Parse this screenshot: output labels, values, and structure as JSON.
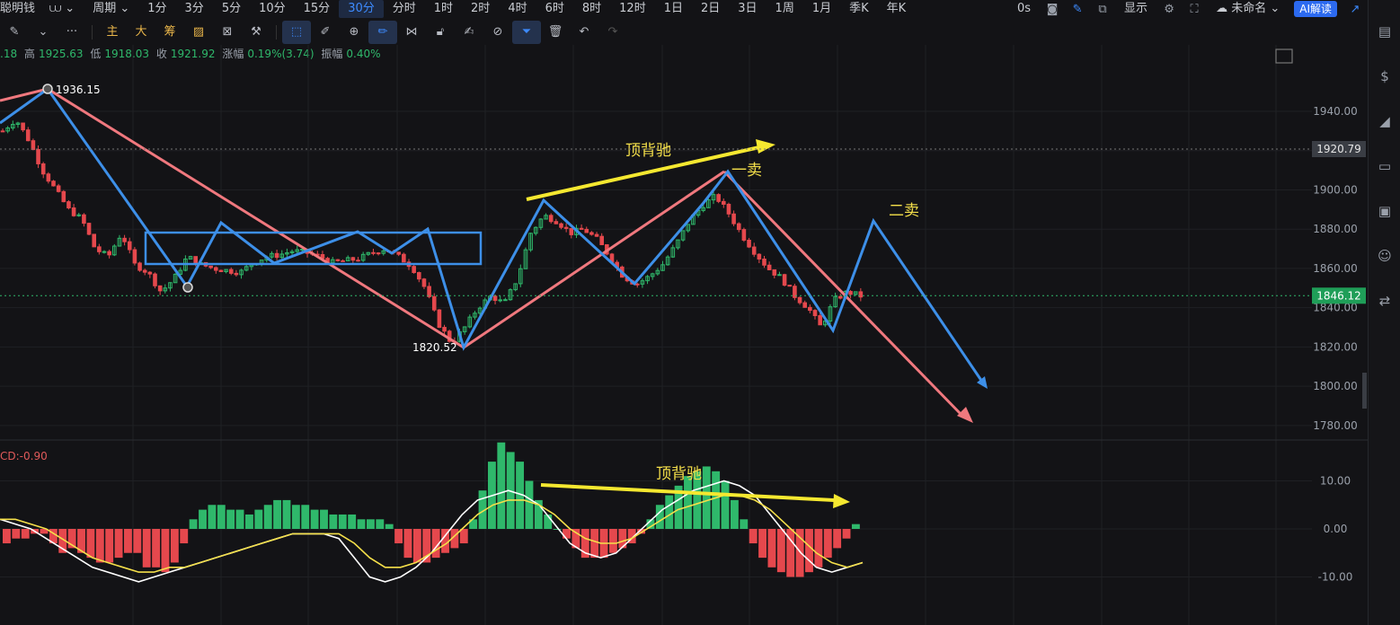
{
  "topbar": {
    "brand": "聪明钱",
    "chart_type_icon": "bar-chart-icon",
    "period_label": "周期",
    "timeframes": [
      "1分",
      "3分",
      "5分",
      "10分",
      "15分",
      "30分",
      "分时",
      "1时",
      "2时",
      "4时",
      "6时",
      "8时",
      "12时",
      "1日",
      "2日",
      "3日",
      "1周",
      "1月",
      "季K",
      "年K"
    ],
    "active_timeframe": "30分",
    "countdown": "0s",
    "display_label": "显示",
    "layout_name": "未命名",
    "ai_button": "AI解读"
  },
  "toolbar": {
    "indicator_buttons": [
      "主",
      "大",
      "筹"
    ],
    "more": "···"
  },
  "ohlc": {
    "open_fragment": ".18",
    "high_label": "高",
    "high": "1925.63",
    "low_label": "低",
    "low": "1918.03",
    "close_label": "收",
    "close": "1921.92",
    "change_label": "涨幅",
    "change": "0.19%(3.74)",
    "amplitude_label": "振幅",
    "amplitude": "0.40%"
  },
  "macd": {
    "label": "CD:-0.90"
  },
  "chart_data": {
    "type": "candlestick",
    "timeframe": "30分",
    "price_axis": {
      "ticks": [
        1940,
        1920,
        1900,
        1880,
        1860,
        1840,
        1820,
        1800,
        1780
      ],
      "tick_labels": [
        "1940.00",
        "1920.00",
        "1900.00",
        "1880.00",
        "1860.00",
        "1840.00",
        "1820.00",
        "1800.00",
        "1780.00"
      ],
      "range": [
        1774,
        1956
      ]
    },
    "macd_axis": {
      "ticks": [
        10,
        0,
        -10
      ],
      "tick_labels": [
        "10.00",
        "0.00",
        "-10.00"
      ],
      "range": [
        -19,
        19
      ]
    },
    "price_markers": [
      {
        "label": "1920.79",
        "value": 1920.79,
        "style": "crosshair"
      },
      {
        "label": "1846.12",
        "value": 1846.12,
        "style": "last-price"
      }
    ],
    "swing_labels": [
      {
        "label": "1936.15",
        "value": 1936.15
      },
      {
        "label": "1820.52",
        "value": 1820.52
      }
    ],
    "annotations": [
      {
        "text": "顶背驰",
        "pane": "price"
      },
      {
        "text": "一卖",
        "pane": "price"
      },
      {
        "text": "二卖",
        "pane": "price"
      },
      {
        "text": "顶背驰",
        "pane": "macd"
      }
    ],
    "candle_anchor_prices": [
      1930,
      1936,
      1925,
      1910,
      1900,
      1890,
      1885,
      1870,
      1866,
      1878,
      1862,
      1858,
      1848,
      1855,
      1866,
      1862,
      1860,
      1859,
      1858,
      1863,
      1866,
      1867,
      1869,
      1868,
      1866,
      1863,
      1864,
      1865,
      1868,
      1870,
      1866,
      1861,
      1850,
      1832,
      1822,
      1830,
      1840,
      1846,
      1842,
      1855,
      1878,
      1887,
      1884,
      1878,
      1880,
      1875,
      1866,
      1856,
      1852,
      1856,
      1862,
      1872,
      1884,
      1892,
      1897,
      1888,
      1877,
      1868,
      1860,
      1855,
      1846,
      1840,
      1830,
      1844,
      1848,
      1846
    ],
    "macd_histogram": [
      -3,
      -2,
      -2,
      -1,
      -1,
      -3,
      -5,
      -4,
      -5,
      -6,
      -7,
      -7,
      -6,
      -5,
      -5,
      -8,
      -8,
      -9,
      -7,
      -3,
      2,
      4,
      5,
      5,
      4,
      4,
      3,
      4,
      5,
      6,
      6,
      5,
      5,
      4,
      4,
      3,
      3,
      3,
      2,
      2,
      2,
      1,
      -3,
      -6,
      -7,
      -7,
      -6,
      -5,
      -4,
      -3,
      2,
      8,
      14,
      18,
      16,
      14,
      10,
      6,
      3,
      0,
      -2,
      -4,
      -6,
      -6,
      -6,
      -5,
      -4,
      -3,
      -1,
      2,
      5,
      7,
      9,
      11,
      12,
      13,
      12,
      10,
      6,
      2,
      -3,
      -6,
      -8,
      -9,
      -10,
      -10,
      -9,
      -8,
      -6,
      -4,
      -2,
      1
    ],
    "dif_line": [
      2,
      1,
      0,
      -2,
      -4,
      -6,
      -8,
      -9,
      -10,
      -11,
      -10,
      -9,
      -8,
      -7,
      -6,
      -5,
      -4,
      -3,
      -2,
      -1,
      -1,
      -1,
      -2,
      -6,
      -10,
      -11,
      -10,
      -8,
      -5,
      -1,
      3,
      6,
      7,
      8,
      7,
      5,
      1,
      -3,
      -5,
      -6,
      -5,
      -2,
      1,
      4,
      6,
      8,
      9,
      10,
      9,
      7,
      3,
      -1,
      -5,
      -8,
      -9,
      -8,
      -7
    ],
    "dea_line": [
      2,
      2,
      1,
      0,
      -2,
      -4,
      -6,
      -7,
      -8,
      -9,
      -9,
      -8,
      -8,
      -7,
      -6,
      -5,
      -4,
      -3,
      -2,
      -1,
      -1,
      -1,
      -1,
      -3,
      -6,
      -8,
      -8,
      -7,
      -5,
      -3,
      0,
      3,
      5,
      6,
      6,
      5,
      3,
      0,
      -2,
      -3,
      -3,
      -2,
      0,
      2,
      4,
      5,
      6,
      7,
      7,
      6,
      4,
      1,
      -2,
      -5,
      -7,
      -8,
      -7
    ]
  },
  "right_panel": {
    "icons": [
      "document-icon",
      "dollar-icon",
      "signal-icon",
      "monitor-icon",
      "etf-icon",
      "robot-icon",
      "exchange-icon"
    ]
  }
}
